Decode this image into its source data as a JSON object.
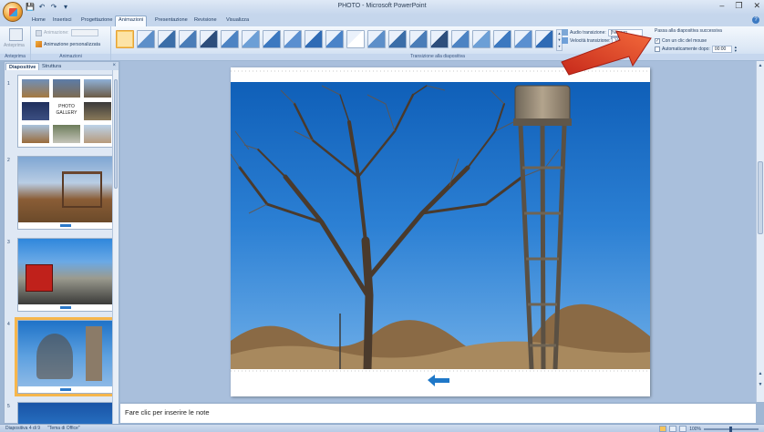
{
  "window": {
    "title": "PHOTO - Microsoft PowerPoint"
  },
  "quick_access": {
    "save": "💾",
    "undo": "↶",
    "redo": "↷",
    "more": "▾"
  },
  "window_controls": {
    "minimize": "–",
    "restore": "❐",
    "close": "✕"
  },
  "tabs": [
    {
      "label": "Home",
      "active": false
    },
    {
      "label": "Inserisci",
      "active": false
    },
    {
      "label": "Progettazione",
      "active": false
    },
    {
      "label": "Animazioni",
      "active": true
    },
    {
      "label": "Presentazione",
      "active": false
    },
    {
      "label": "Revisione",
      "active": false
    },
    {
      "label": "Visualizza",
      "active": false
    }
  ],
  "help": "?",
  "ribbon": {
    "groups": {
      "anteprima": {
        "label": "Anteprima",
        "button": "Anteprima"
      },
      "animazioni": {
        "label": "Animazioni",
        "animate_label": "Animazione:",
        "custom_label": "Animazione personalizzata"
      },
      "transizione": {
        "label": "Transizione alla diapositiva"
      }
    },
    "transition_options": {
      "audio_label": "Audio transizione:",
      "audio_value": "[Nessun segn...",
      "speed_label": "Velocità transizione:",
      "speed_value": "Veloce"
    },
    "advance": {
      "title": "Passa alla diapositiva successiva",
      "on_click_label": "Con un clic del mouse",
      "on_click_checked": true,
      "auto_label": "Automaticamente dopo:",
      "auto_checked": false,
      "auto_time": "00:00"
    }
  },
  "left_pane": {
    "tabs": [
      "Diapositive",
      "Struttura"
    ],
    "close": "×",
    "slides": [
      {
        "number": "1",
        "title": "PHOTO\nGALLERY",
        "selected": false
      },
      {
        "number": "2",
        "selected": false
      },
      {
        "number": "3",
        "selected": false
      },
      {
        "number": "4",
        "selected": true
      },
      {
        "number": "5",
        "selected": false
      }
    ]
  },
  "notes": {
    "placeholder": "Fare clic per inserire le note"
  },
  "status_bar": {
    "slide_info": "Diapositiva 4 di 9",
    "theme": "\"Tema di Office\"",
    "zoom": "100%"
  },
  "colors": {
    "accent": "#f6b64c",
    "arrow": "#e84a2e",
    "sky": "#2f7fd0"
  }
}
